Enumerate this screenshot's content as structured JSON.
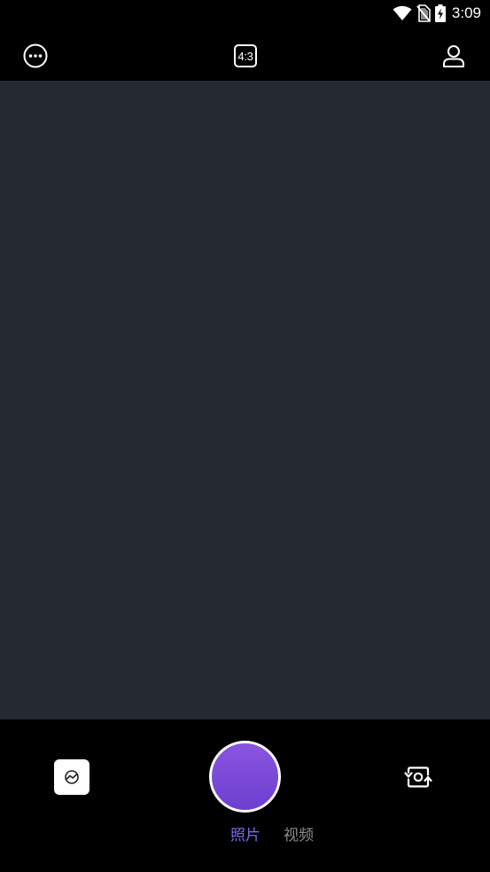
{
  "status_bar": {
    "time": "3:09",
    "icons": [
      "wifi-icon",
      "no-sim-icon",
      "battery-charging-icon"
    ]
  },
  "top_bar": {
    "more_icon": "more-options-icon",
    "aspect_ratio_label": "4:3",
    "profile_icon": "profile-icon"
  },
  "viewfinder": {
    "background_color": "#252a32"
  },
  "bottom_bar": {
    "gallery_icon": "gallery-icon",
    "shutter_color": "#7b4ad9",
    "switch_camera_icon": "switch-camera-icon",
    "modes": [
      {
        "label": "照片",
        "selected": true,
        "color": "#7a6cf0"
      },
      {
        "label": "视频",
        "selected": false,
        "color": "#8c8c8c"
      }
    ]
  }
}
